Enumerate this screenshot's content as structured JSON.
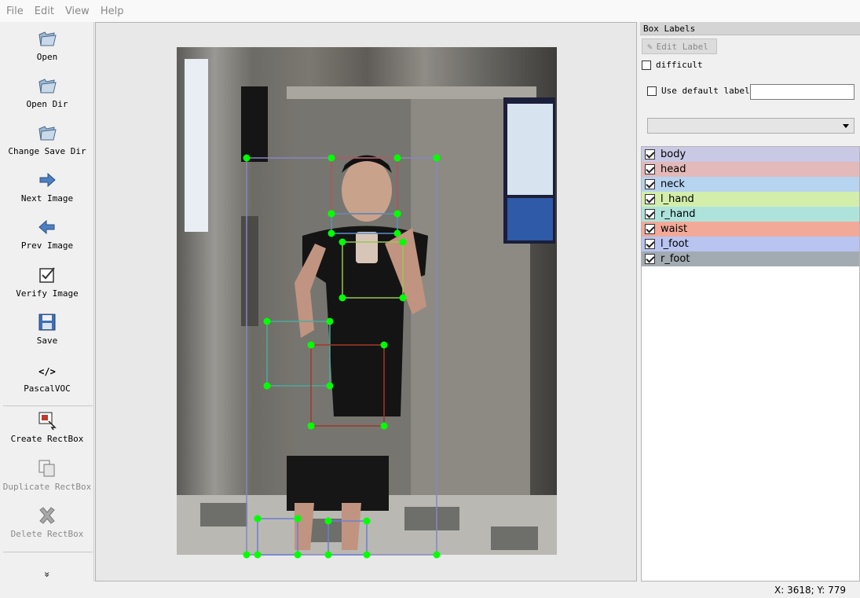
{
  "menu": [
    "File",
    "Edit",
    "View",
    "Help"
  ],
  "toolbar": {
    "open": "Open",
    "open_dir": "Open Dir",
    "change_save_dir": "Change Save Dir",
    "next_image": "Next Image",
    "prev_image": "Prev Image",
    "verify_image": "Verify Image",
    "save": "Save",
    "format": "PascalVOC",
    "format_icon": "</>",
    "create_rectbox": "Create RectBox",
    "duplicate_rectbox": "Duplicate RectBox",
    "delete_rectbox": "Delete RectBox",
    "more": "»"
  },
  "panel": {
    "title": "Box Labels",
    "edit_label": "Edit Label",
    "difficult": "difficult",
    "use_default_label": "Use default label",
    "default_label_value": "",
    "combo_value": ""
  },
  "labels": [
    {
      "name": "body",
      "color": "#c9c9e6",
      "checked": true
    },
    {
      "name": "head",
      "color": "#e3b9b9",
      "checked": true
    },
    {
      "name": "neck",
      "color": "#b6d3f0",
      "checked": true
    },
    {
      "name": "l_hand",
      "color": "#d3eeaa",
      "checked": true
    },
    {
      "name": "r_hand",
      "color": "#aee3dc",
      "checked": true
    },
    {
      "name": "waist",
      "color": "#f2a998",
      "checked": true
    },
    {
      "name": "l_foot",
      "color": "#b9c4f0",
      "checked": true
    },
    {
      "name": "r_foot",
      "color": "#a2abb2",
      "checked": true
    }
  ],
  "status": {
    "coords": "X: 3618; Y: 779"
  },
  "colors": {
    "accent": "#00ff00",
    "box": "#7f7fbf"
  }
}
